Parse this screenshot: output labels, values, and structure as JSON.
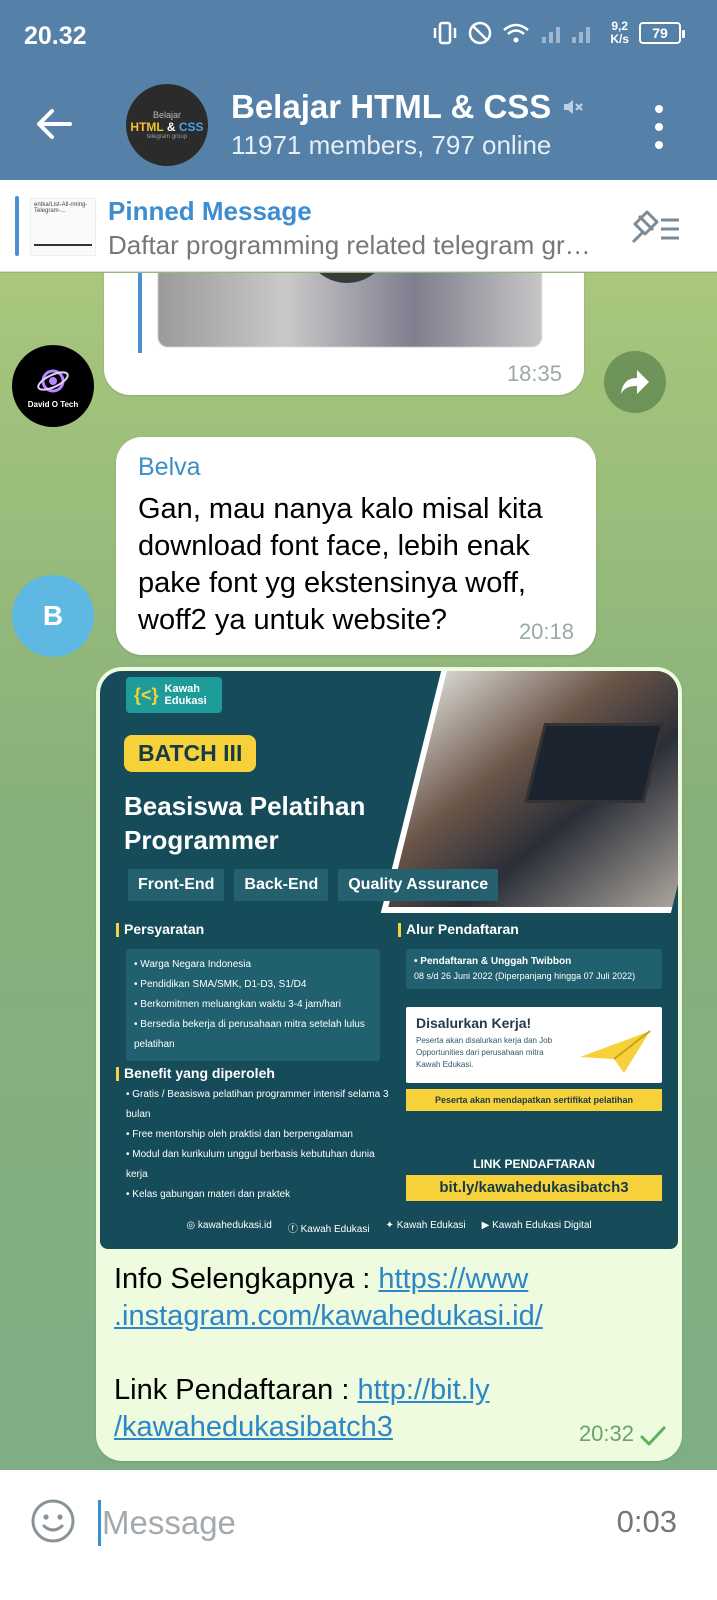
{
  "status": {
    "time": "20.32",
    "speed_value": "9,2",
    "speed_unit": "K/s",
    "battery": "79"
  },
  "header": {
    "title": "Belajar HTML & CSS",
    "subtitle": "11971 members, 797 online",
    "avatar_line1": "Belajar",
    "avatar_html": "HTML",
    "avatar_amp": "&",
    "avatar_css": "CSS",
    "avatar_line3": "telegram group",
    "muted_icon": "muted-speaker-icon",
    "menu_icon": "three-dots-icon"
  },
  "pinned": {
    "title": "Pinned Message",
    "text": "Daftar programming related telegram gr…",
    "thumb_text": "entka/List-All-rming-Telegram-..."
  },
  "messages": [
    {
      "time": "18:35",
      "avatar_label": "David O Tech"
    },
    {
      "sender": "Belva",
      "text": "Gan, mau nanya kalo misal kita download font face, lebih enak pake font yg ekstensinya woff, woff2 ya untuk website?",
      "time": "20:18",
      "avatar_initial": "B"
    },
    {
      "info_label": "Info Selengkapnya : ",
      "info_link_line1": "https://www",
      "info_link_line2": ".instagram.com/kawahedukasi.id/",
      "reg_label": "Link Pendaftaran : ",
      "reg_link_line1": "http://bit.ly",
      "reg_link_line2": "/kawahedukasibatch3",
      "time": "20:32"
    }
  ],
  "poster": {
    "brand_line1": "Kawah",
    "brand_line2": "Edukasi",
    "batch": "BATCH III",
    "title_line1": "Beasiswa Pelatihan",
    "title_line2": "Programmer",
    "tags": [
      "Front-End",
      "Back-End",
      "Quality Assurance"
    ],
    "req_title": "Persyaratan",
    "req_items": [
      "Warga Negara Indonesia",
      "Pendidikan SMA/SMK, D1-D3, S1/D4",
      "Berkomitmen meluangkan waktu 3-4 jam/hari",
      "Bersedia bekerja di perusahaan mitra setelah lulus pelatihan"
    ],
    "benefit_title": "Benefit yang diperoleh",
    "benefit_items": [
      "Gratis / Beasiswa pelatihan programmer intensif selama 3 bulan",
      "Free mentorship oleh praktisi dan berpengalaman",
      "Modul dan kurikulum unggul berbasis kebutuhan dunia kerja",
      "Kelas gabungan materi dan praktek"
    ],
    "flow_title": "Alur Pendaftaran",
    "flow_item": "Pendaftaran & Unggah Twibbon",
    "flow_date": "08 s/d 26 Juni 2022 (Diperpanjang hingga 07 Juli 2022)",
    "card_title": "Disalurkan Kerja!",
    "card_desc": "Peserta akan disalurkan kerja dan Job Opportunities dari perusahaan mitra Kawah Edukasi.",
    "cert": "Peserta akan mendapatkan sertifikat pelatihan",
    "link_title": "LINK PENDAFTARAN",
    "link": "bit.ly/kawahedukasibatch3",
    "footer": [
      "kawahedukasi.id",
      "Kawah Edukasi",
      "Kawah Edukasi",
      "Kawah Edukasi Digital"
    ]
  },
  "input": {
    "placeholder": "Message",
    "record_time": "0:03"
  }
}
